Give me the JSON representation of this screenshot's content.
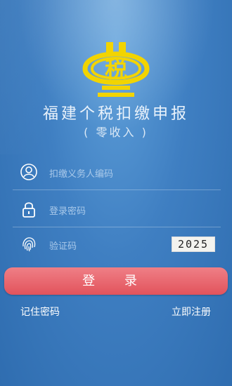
{
  "header": {
    "title": "福建个税扣缴申报",
    "subtitle": "( 零收入 )",
    "emblem_text": "税"
  },
  "form": {
    "taxpayer_code_placeholder": "扣缴义务人编码",
    "password_placeholder": "登录密码",
    "captcha_placeholder": "验证码",
    "captcha_code": "2025"
  },
  "actions": {
    "login_label": "登 录",
    "remember_password": "记住密码",
    "register_now": "立即注册"
  },
  "colors": {
    "accent_button": "#e2535c",
    "emblem": "#f2d400"
  }
}
